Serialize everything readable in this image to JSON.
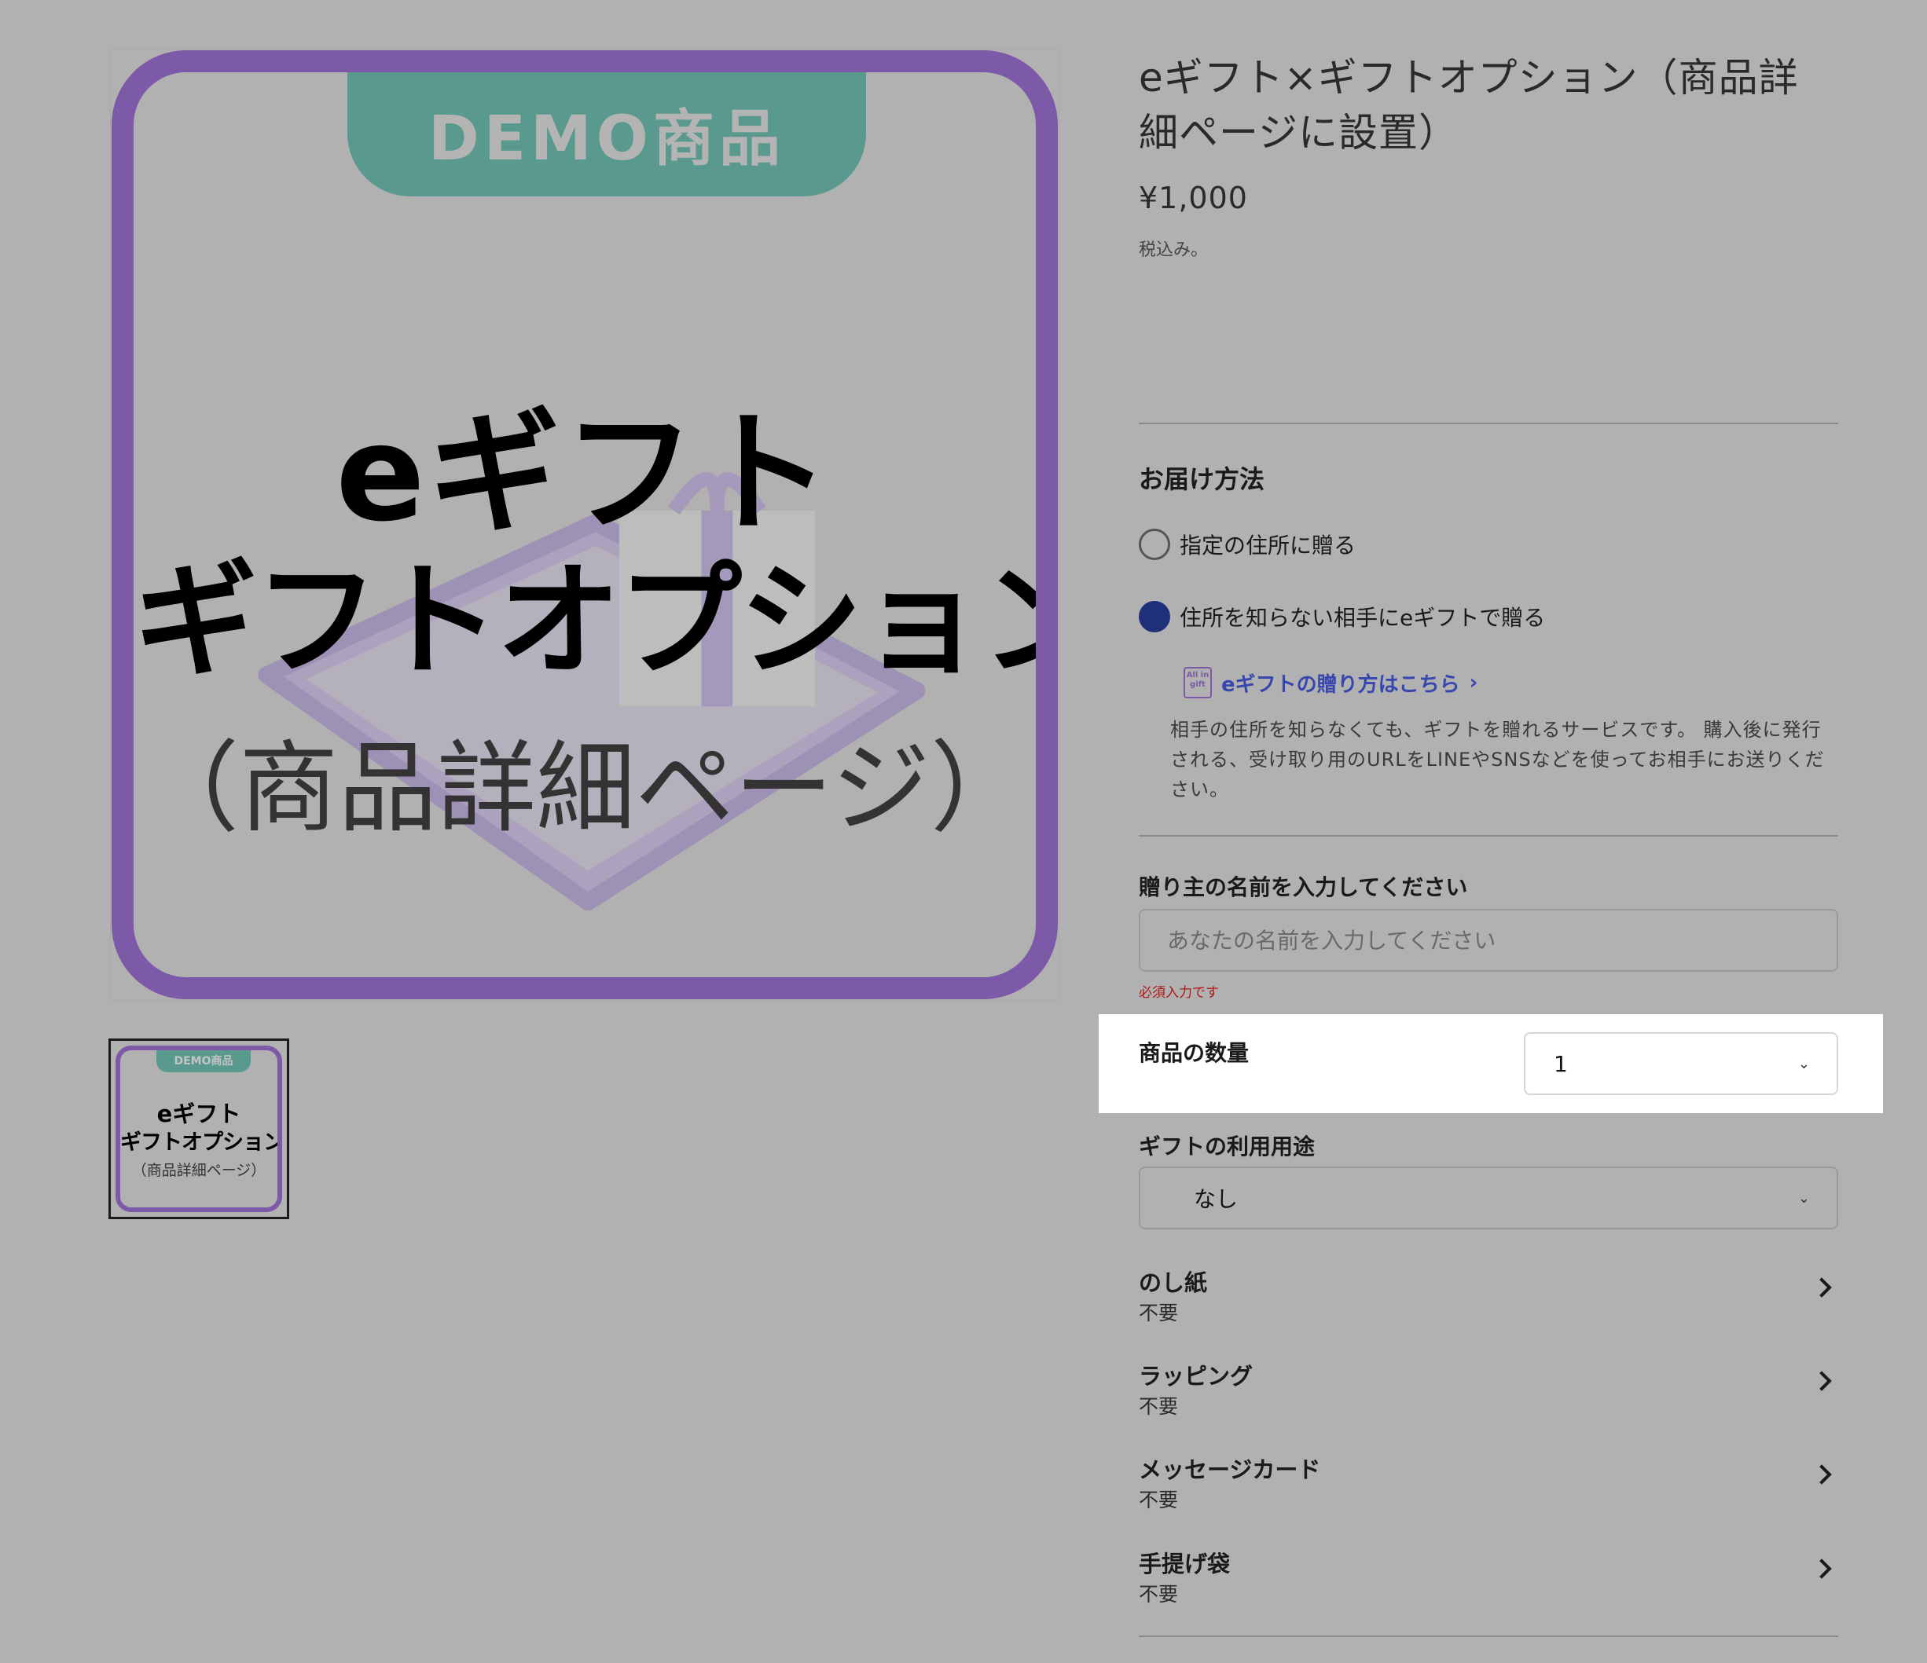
{
  "product_image": {
    "demo_badge": "DEMO商品",
    "line1": "eギフト",
    "line2": "ギフトオプション",
    "line3": "（商品詳細ページ）"
  },
  "thumbnail": {
    "demo_badge": "DEMO商品",
    "line1": "eギフト",
    "line2": "ギフトオプション",
    "line3": "（商品詳細ページ）"
  },
  "product": {
    "title_line1": "eギフト×ギフトオプション（商品詳",
    "title_line2": "細ページに設置）",
    "price": "¥1,000",
    "tax_note": "税込み。"
  },
  "delivery": {
    "heading": "お届け方法",
    "option_address": "指定の住所に贈る",
    "option_egift": "住所を知らない相手にeギフトで贈る",
    "selected": "option_egift",
    "egift_link_label": "eギフトの贈り方はこちら",
    "egift_logo_text": "All in gift",
    "egift_description": "相手の住所を知らなくても、ギフトを贈れるサービスです。 購入後に発行される、受け取り用のURLをLINEやSNSなどを使ってお相手にお送りください。"
  },
  "sender": {
    "label": "贈り主の名前を入力してください",
    "placeholder": "あなたの名前を入力してください",
    "value": "",
    "error": "必須入力です"
  },
  "quantity": {
    "label": "商品の数量",
    "value": "1"
  },
  "gift_use": {
    "label": "ギフトの利用用途",
    "value": "なし"
  },
  "options": [
    {
      "title": "のし紙",
      "value": "不要"
    },
    {
      "title": "ラッピング",
      "value": "不要"
    },
    {
      "title": "メッセージカード",
      "value": "不要"
    },
    {
      "title": "手提げ袋",
      "value": "不要"
    }
  ],
  "colors": {
    "overlay_gray": "#b1b1b1",
    "frame_purple": "#7c5aa8",
    "badge_teal": "#5a9a8e",
    "radio_selected": "#1f2f7a",
    "link_blue": "#3846b0",
    "error_red": "#b01818"
  }
}
